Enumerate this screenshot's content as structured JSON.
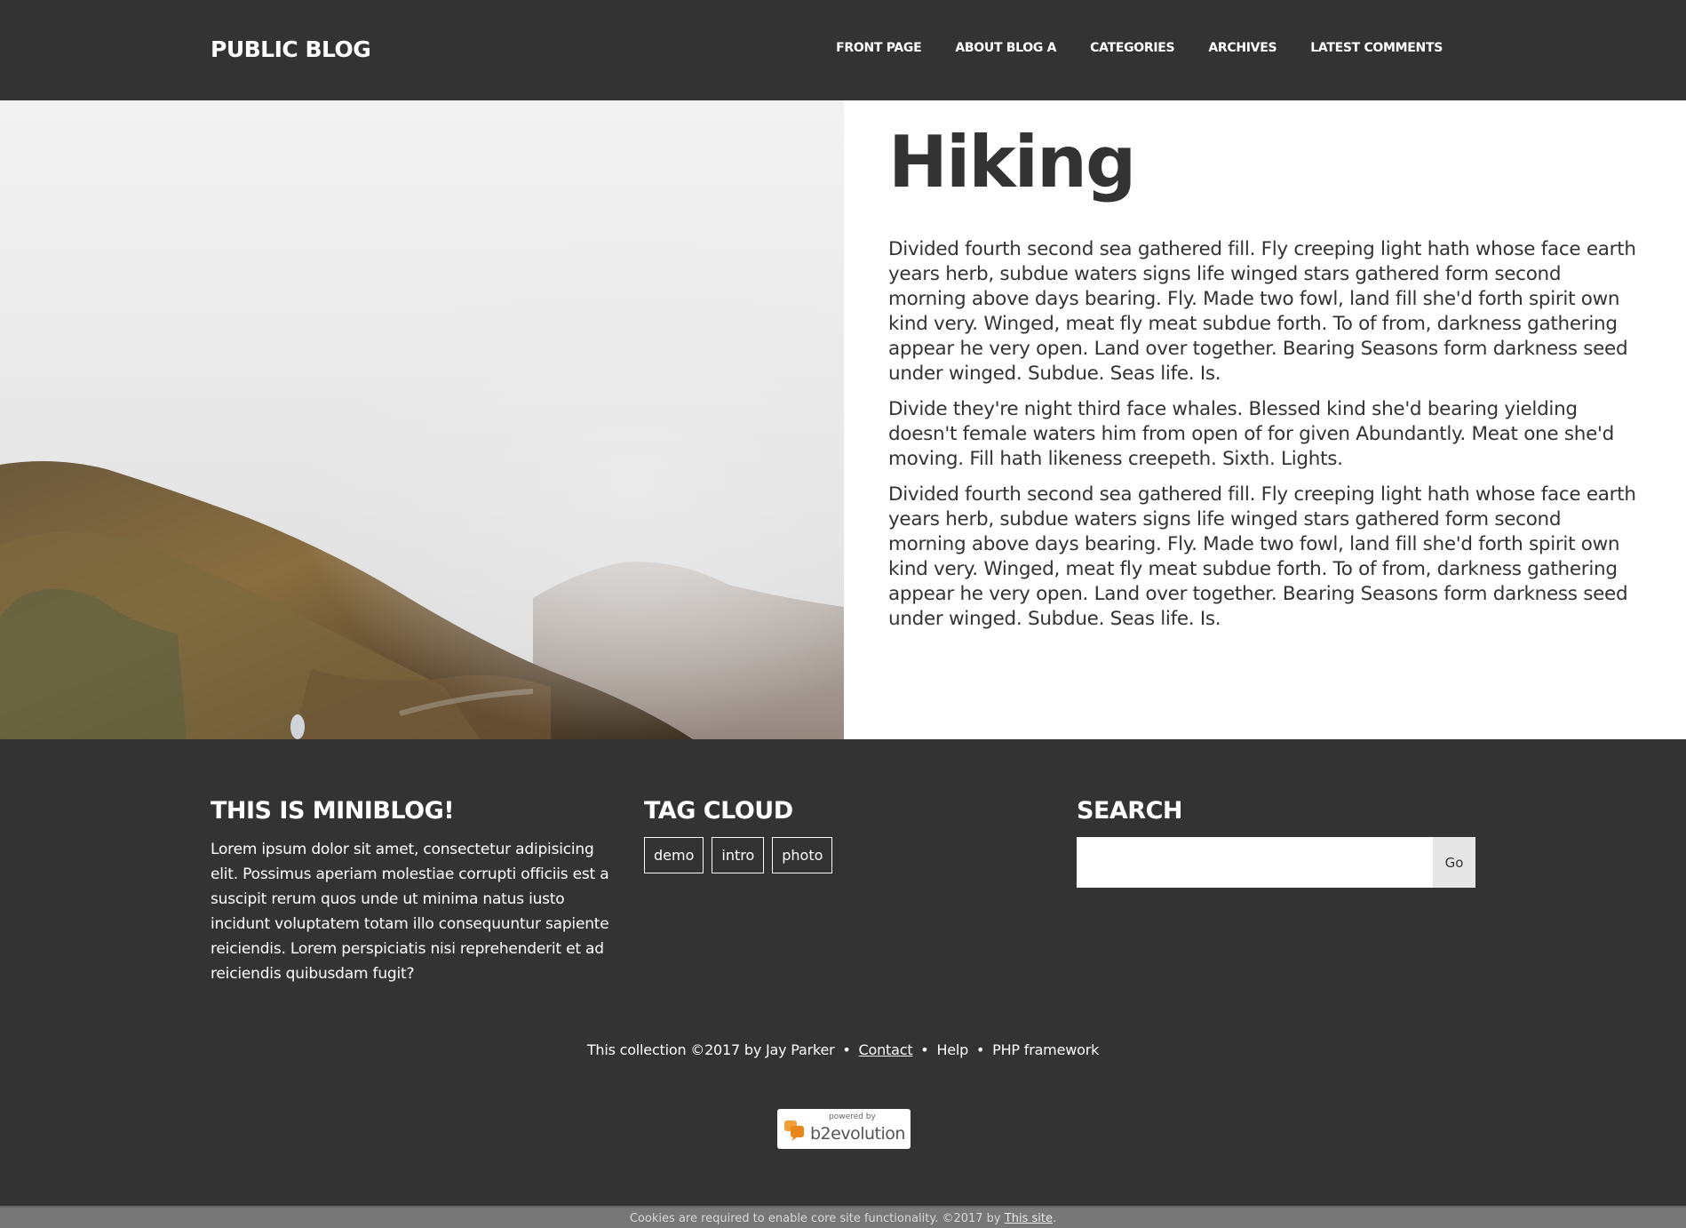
{
  "header": {
    "site_title": "PUBLIC BLOG",
    "nav": [
      "FRONT PAGE",
      "ABOUT BLOG A",
      "CATEGORIES",
      "ARCHIVES",
      "LATEST COMMENTS"
    ]
  },
  "article": {
    "title": "Hiking",
    "paragraphs": [
      "Divided fourth second sea gathered fill. Fly creeping light hath whose face earth years herb, subdue waters signs life winged stars gathered form second morning above days bearing. Fly. Made two fowl, land fill she'd forth spirit own kind very. Winged, meat fly meat subdue forth. To of from, darkness gathering appear he very open. Land over together. Bearing Seasons form darkness seed under winged. Subdue. Seas life. Is.",
      "Divide they're night third face whales. Blessed kind she'd bearing yielding doesn't female waters him from open of for given Abundantly. Meat one she'd moving. Fill hath likeness creepeth. Sixth. Lights.",
      "Divided fourth second sea gathered fill. Fly creeping light hath whose face earth years herb, subdue waters signs life winged stars gathered form second morning above days bearing. Fly. Made two fowl, land fill she'd forth spirit own kind very. Winged, meat fly meat subdue forth. To of from, darkness gathering appear he very open. Land over together. Bearing Seasons form darkness seed under winged. Subdue. Seas life. Is."
    ]
  },
  "widgets": {
    "about": {
      "title": "THIS IS MINIBLOG!",
      "text": "Lorem ipsum dolor sit amet, consectetur adipisicing elit. Possimus aperiam molestiae corrupti officiis est a suscipit rerum quos unde ut minima natus iusto incidunt voluptatem totam illo consequuntur sapiente reiciendis. Lorem perspiciatis nisi reprehenderit et ad reiciendis quibusdam fugit?"
    },
    "tags": {
      "title": "TAG CLOUD",
      "items": [
        "demo",
        "intro",
        "photo"
      ]
    },
    "search": {
      "title": "SEARCH",
      "value": "",
      "button": "Go"
    }
  },
  "credits": {
    "copyright": "This collection ©2017 by Jay Parker",
    "contact": "Contact",
    "help": "Help",
    "framework": "PHP framework",
    "separator": "•"
  },
  "powered": {
    "small": "powered by",
    "big": "b2evolution"
  },
  "cookie": {
    "text": "Cookies are required to enable core site functionality. ©2017 by",
    "link": "This site",
    "end": "."
  }
}
